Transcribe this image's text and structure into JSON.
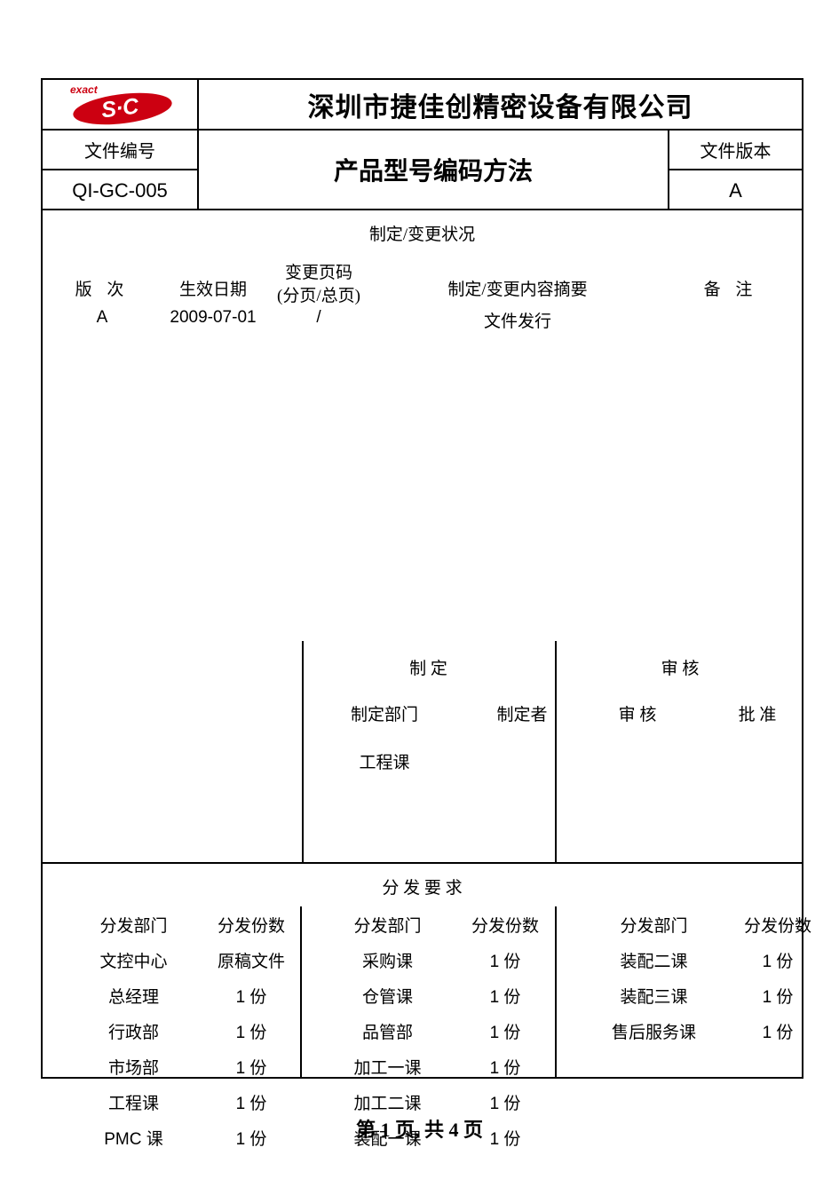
{
  "document": {
    "company_name": "深圳市捷佳创精密设备有限公司",
    "logo": {
      "mark_text": "S·C",
      "tagline": "exact",
      "color": "#cc0011"
    },
    "meta": {
      "doc_no_label": "文件编号",
      "doc_no_value": "QI-GC-005",
      "title": "产品型号编码方法",
      "version_label": "文件版本",
      "version_value": "A"
    },
    "revision": {
      "section_title": "制定/变更状况",
      "headers": {
        "version": "版 次",
        "effective_date": "生效日期",
        "change_pages_line1": "变更页码",
        "change_pages_line2": "(分页/总页)",
        "summary": "制定/变更内容摘要",
        "remark": "备 注"
      },
      "rows": [
        {
          "version": "A",
          "effective_date": "2009-07-01",
          "change_pages": "/",
          "summary": "文件发行",
          "remark": ""
        }
      ]
    },
    "approval": {
      "make_title": "制  定",
      "check_title": "审  核",
      "make_dept_label": "制定部门",
      "maker_label": "制定者",
      "checker_label": "审  核",
      "approver_label": "批  准",
      "make_dept_value": "工程课",
      "maker_value": "",
      "checker_value": "",
      "approver_value": ""
    },
    "distribution": {
      "section_title": "分 发 要 求",
      "headers": {
        "dept": "分发部门",
        "qty": "分发份数"
      },
      "rows": [
        {
          "b1_dept": "文控中心",
          "b1_qty": "原稿文件",
          "b2_dept": "采购课",
          "b2_qty": "1 份",
          "b3_dept": "装配二课",
          "b3_qty": "1 份"
        },
        {
          "b1_dept": "总经理",
          "b1_qty": "1 份",
          "b2_dept": "仓管课",
          "b2_qty": "1 份",
          "b3_dept": "装配三课",
          "b3_qty": "1 份"
        },
        {
          "b1_dept": "行政部",
          "b1_qty": "1 份",
          "b2_dept": "品管部",
          "b2_qty": "1 份",
          "b3_dept": "售后服务课",
          "b3_qty": "1 份"
        },
        {
          "b1_dept": "市场部",
          "b1_qty": "1 份",
          "b2_dept": "加工一课",
          "b2_qty": "1 份",
          "b3_dept": "",
          "b3_qty": ""
        },
        {
          "b1_dept": "工程课",
          "b1_qty": "1 份",
          "b2_dept": "加工二课",
          "b2_qty": "1 份",
          "b3_dept": "",
          "b3_qty": ""
        },
        {
          "b1_dept": "PMC 课",
          "b1_qty": "1 份",
          "b2_dept": "装配一课",
          "b2_qty": "1 份",
          "b3_dept": "",
          "b3_qty": ""
        }
      ]
    },
    "footer": {
      "page_text": "第 1 页, 共 4 页"
    }
  }
}
